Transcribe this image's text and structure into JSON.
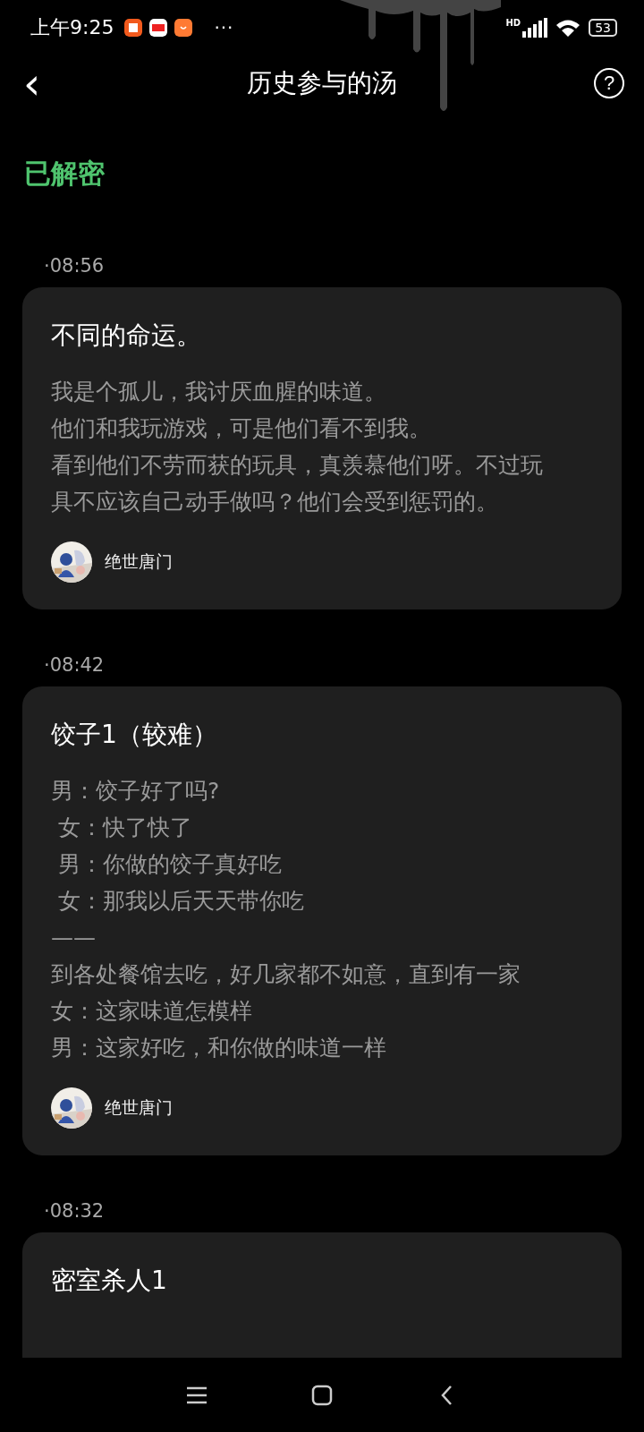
{
  "status_bar": {
    "time": "上午9:25",
    "more": "···",
    "network": "HD",
    "battery": "53"
  },
  "header": {
    "back": "‹",
    "title": "历史参与的汤",
    "help": "?"
  },
  "section_title": "已解密",
  "entries": [
    {
      "time": "·08:56",
      "title": "不同的命运。",
      "lines": [
        "我是个孤儿，我讨厌血腥的味道。",
        "他们和我玩游戏，可是他们看不到我。",
        "看到他们不劳而获的玩具，真羡慕他们呀。不过玩具不应该自己动手做吗？他们会受到惩罚的。"
      ],
      "author": "绝世唐门"
    },
    {
      "time": "·08:42",
      "title": "饺子1（较难）",
      "lines": [
        "男：饺子好了吗?",
        " 女：快了快了",
        " 男：你做的饺子真好吃",
        " 女：那我以后天天带你吃",
        "——",
        "到各处餐馆去吃，好几家都不如意，直到有一家",
        "女：这家味道怎模样",
        "男：这家好吃，和你做的味道一样"
      ],
      "author": "绝世唐门"
    },
    {
      "time": "·08:32",
      "title": "密室杀人1"
    }
  ]
}
